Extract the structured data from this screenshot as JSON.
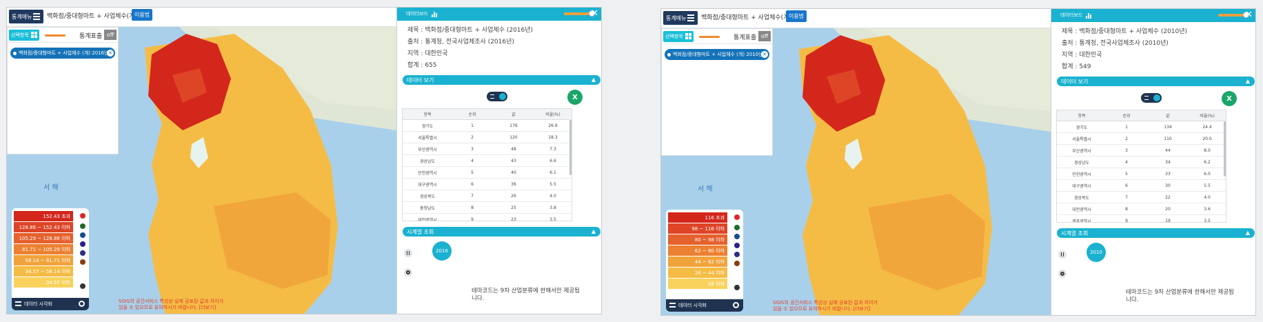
{
  "screens": [
    {
      "menu_label": "통계메뉴",
      "topic": "백화점/중대형마트 + 사업체수(개)",
      "usage_button": "이용법",
      "left_panel": {
        "tab_label": "선택항목",
        "stat_label": "통계표출",
        "off_label": "off",
        "selected_item": "백화점/중대형마트 + 사업체수 (개) 2016년"
      },
      "sea_label": "서 해",
      "legend": {
        "rows": [
          "152.43 초과",
          "128.86 ~ 152.43 이하",
          "105.29 ~ 128.86 이하",
          "81.71 ~ 105.29 이하",
          "58.14 ~ 81.71 이하",
          "34.57 ~ 58.14 이하",
          "34.57 이하"
        ],
        "colors": [
          "#d3271c",
          "#de4527",
          "#e5612d",
          "#ec8131",
          "#f1a33b",
          "#f5bc45",
          "#f8d25c"
        ],
        "footer_label": "데이터 시각화"
      },
      "notice_lines": [
        "SGIS의 공간서비스 특성상 실제 공표된 값과 차이가",
        "있을 수 있으므로 유의하시기 바랍니다. [더보기]"
      ],
      "dashboard": {
        "title": "데이터보드",
        "info": {
          "title": "제목 : 백화점/중대형마트 + 사업체수 (2016년)",
          "source": "출처 : 통계청, 전국사업체조사 (2016년)",
          "region": "지역 : 대한민국",
          "total": "합계 : 655"
        },
        "data_section": "데이터 보기",
        "excel_icon": "X",
        "table": {
          "headers": [
            "항목",
            "순위",
            "값",
            "비율(%)"
          ],
          "rows": [
            [
              "경기도",
              "1",
              "176",
              "26.9"
            ],
            [
              "서울특별시",
              "2",
              "120",
              "18.3"
            ],
            [
              "부산광역시",
              "3",
              "48",
              "7.3"
            ],
            [
              "경상남도",
              "4",
              "43",
              "6.6"
            ],
            [
              "인천광역시",
              "5",
              "40",
              "6.1"
            ],
            [
              "대구광역시",
              "6",
              "36",
              "5.5"
            ],
            [
              "경상북도",
              "7",
              "26",
              "4.0"
            ],
            [
              "충청남도",
              "8",
              "25",
              "3.8"
            ],
            [
              "대전광역시",
              "9",
              "23",
              "3.5"
            ]
          ]
        },
        "timeseries_section": "시계열 조회",
        "year": "2016",
        "note": "테마코드는 9차 산업분류에 한해서만 제공됩니다."
      }
    },
    {
      "menu_label": "통계메뉴",
      "topic": "백화점/중대형마트 + 사업체수(개)",
      "usage_button": "이용법",
      "left_panel": {
        "tab_label": "선택항목",
        "stat_label": "통계표출",
        "off_label": "off",
        "selected_item": "백화점/중대형마트 + 사업체수 (개) 2010년"
      },
      "sea_label": "서 해",
      "legend": {
        "rows": [
          "116 초과",
          "98 ~ 116 이하",
          "80 ~ 98 이하",
          "62 ~ 80 이하",
          "44 ~ 62 이하",
          "26 ~ 44 이하",
          "26 이하"
        ],
        "colors": [
          "#d3271c",
          "#de4527",
          "#e5612d",
          "#ec8131",
          "#f1a33b",
          "#f5bc45",
          "#f8d25c"
        ],
        "footer_label": "데이터 시각화"
      },
      "notice_lines": [
        "SGIS의 공간서비스 특성상 실제 공표된 값과 차이가",
        "있을 수 있으므로 유의하시기 바랍니다. [더보기]"
      ],
      "dashboard": {
        "title": "데이터보드",
        "info": {
          "title": "제목 : 백화점/중대형마트 + 사업체수 (2010년)",
          "source": "출처 : 통계청, 전국사업체조사 (2010년)",
          "region": "지역 : 대한민국",
          "total": "합계 : 549"
        },
        "data_section": "데이터 보기",
        "excel_icon": "X",
        "table": {
          "headers": [
            "항목",
            "순위",
            "값",
            "비율(%)"
          ],
          "rows": [
            [
              "경기도",
              "1",
              "134",
              "24.4"
            ],
            [
              "서울특별시",
              "2",
              "110",
              "20.0"
            ],
            [
              "부산광역시",
              "3",
              "44",
              "8.0"
            ],
            [
              "경상남도",
              "4",
              "34",
              "6.2"
            ],
            [
              "인천광역시",
              "5",
              "33",
              "6.0"
            ],
            [
              "대구광역시",
              "6",
              "30",
              "5.5"
            ],
            [
              "경상북도",
              "7",
              "22",
              "4.0"
            ],
            [
              "대전광역시",
              "8",
              "20",
              "3.6"
            ],
            [
              "광주광역시",
              "9",
              "19",
              "3.5"
            ]
          ]
        },
        "timeseries_section": "시계열 조회",
        "year": "2010",
        "note": "테마코드는 9차 산업분류에 한해서만 제공됩니다."
      }
    }
  ]
}
